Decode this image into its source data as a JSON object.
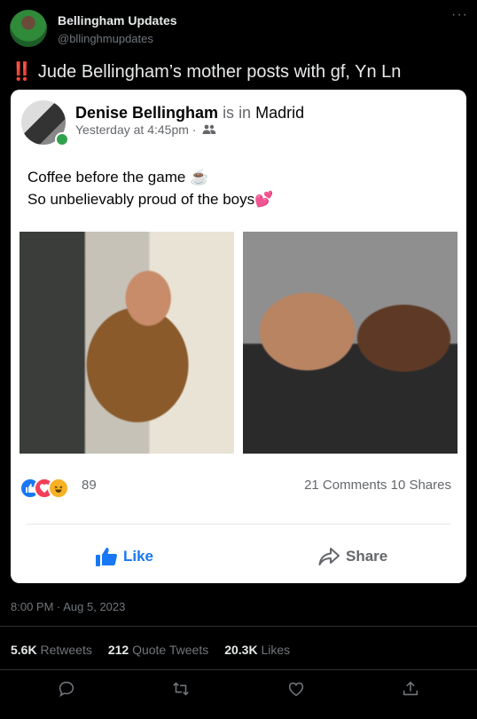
{
  "tweet": {
    "display_name": "Bellingham Updates",
    "handle": "@bllinghmupdates",
    "more_icon": "···",
    "alert_icon": "‼️",
    "text": "Jude Bellingham’s mother posts with gf, Yn Ln",
    "timestamp": "8:00 PM · Aug 5, 2023",
    "retweets": "5.6K",
    "retweets_label": "Retweets",
    "quote_tweets": "212",
    "quote_tweets_label": "Quote Tweets",
    "likes": "20.3K",
    "likes_label": "Likes"
  },
  "fb_post": {
    "author": "Denise Bellingham",
    "is_in": "is in",
    "location": "Madrid",
    "time": "Yesterday at 4:45pm ·",
    "line1": "Coffee before the game ☕",
    "line2": "So unbelievably proud of the boys💕",
    "reaction_count": "89",
    "comments": "21 Comments",
    "shares": "10 Shares",
    "like_label": "Like",
    "share_label": "Share"
  },
  "colors": {
    "accent": "#1877f2",
    "love": "#f33e58",
    "haha": "#f7b125",
    "online": "#31a24c",
    "alert": "#e0245e"
  }
}
